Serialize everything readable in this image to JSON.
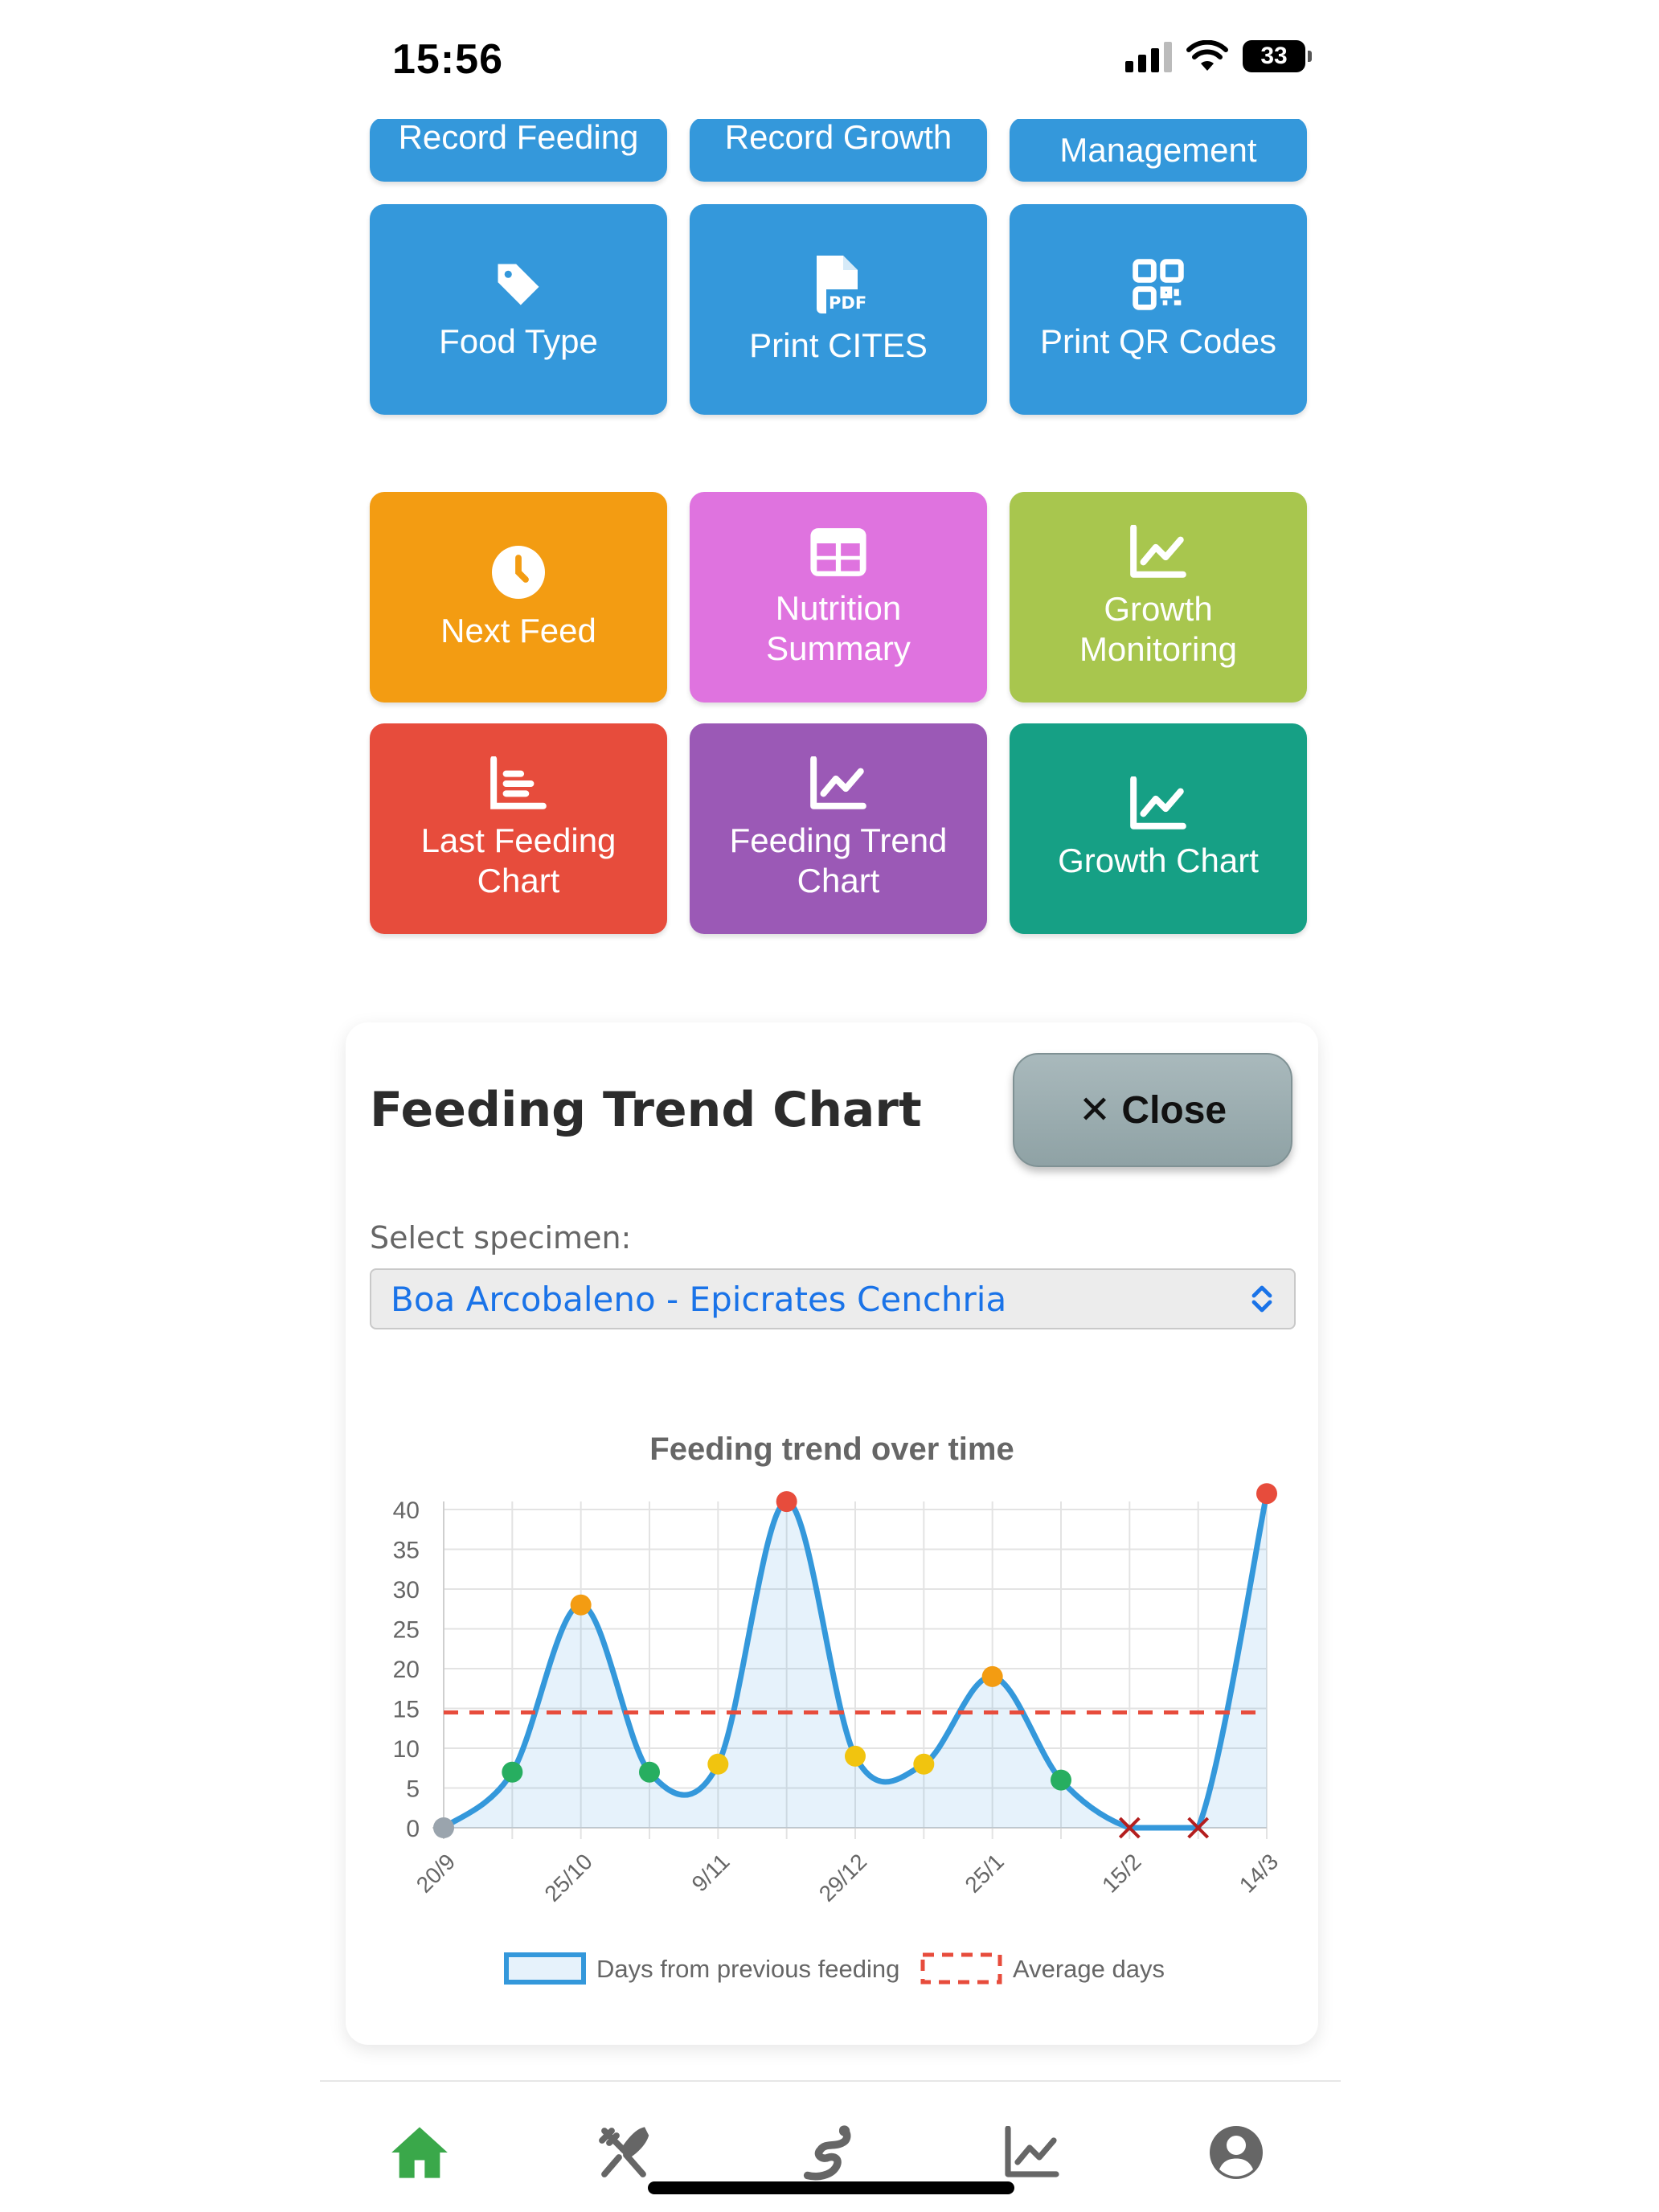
{
  "status_bar": {
    "time": "15:56",
    "battery": "33"
  },
  "tiles_top_partial": [
    {
      "label": "Record Feeding"
    },
    {
      "label": "Record Growth"
    },
    {
      "label": "Management"
    }
  ],
  "tiles_row1": [
    {
      "label": "Food Type",
      "icon": "tag-icon"
    },
    {
      "label": "Print CITES",
      "icon": "pdf-file-icon"
    },
    {
      "label": "Print QR Codes",
      "icon": "qr-code-icon"
    }
  ],
  "tiles_row2": [
    {
      "label": "Next Feed",
      "icon": "clock-icon",
      "color": "#f39c12"
    },
    {
      "label": "Nutrition Summary",
      "icon": "table-icon",
      "color": "#df73df"
    },
    {
      "label": "Growth Monitoring",
      "icon": "line-chart-icon",
      "color": "#a8c64e"
    }
  ],
  "tiles_row3": [
    {
      "label": "Last Feeding Chart",
      "icon": "bar-chart-icon",
      "color": "#e74c3c"
    },
    {
      "label": "Feeding Trend Chart",
      "icon": "line-chart-icon",
      "color": "#9b59b6"
    },
    {
      "label": "Growth Chart",
      "icon": "line-chart-icon",
      "color": "#16a085"
    }
  ],
  "card": {
    "title": "Feeding Trend Chart",
    "close_label": "✕ Close",
    "select_label": "Select specimen:",
    "select_value": "Boa Arcobaleno - Epicrates Cenchria"
  },
  "chart_data": {
    "type": "line",
    "title": "Feeding trend over time",
    "x": [
      "20/9",
      "",
      "25/10",
      "",
      "9/11",
      "",
      "29/12",
      "",
      "25/1",
      "",
      "15/2",
      "",
      "14/3"
    ],
    "series": [
      {
        "name": "Days from previous feeding",
        "values": [
          0,
          7,
          28,
          7,
          8,
          41,
          9,
          8,
          19,
          6,
          0,
          0,
          42
        ],
        "point_colors": [
          "#9aa4ad",
          "#27ae60",
          "#f39c12",
          "#27ae60",
          "#f1c40f",
          "#e74c3c",
          "#f1c40f",
          "#f1c40f",
          "#f39c12",
          "#27ae60",
          "cross",
          "cross",
          "#e74c3c"
        ],
        "color": "#3498db"
      },
      {
        "name": "Average days",
        "values": [
          14.5,
          14.5,
          14.5,
          14.5,
          14.5,
          14.5,
          14.5,
          14.5,
          14.5,
          14.5,
          14.5,
          14.5,
          14.5
        ],
        "color": "#e74c3c",
        "style": "dashed"
      }
    ],
    "ylim": [
      0,
      40
    ],
    "yticks": [
      0,
      5,
      10,
      15,
      20,
      25,
      30,
      35,
      40
    ],
    "grid": true,
    "legend": "bottom"
  },
  "bottom_nav": [
    {
      "name": "home",
      "active_color": "#3aa84a"
    },
    {
      "name": "feeding"
    },
    {
      "name": "specimens"
    },
    {
      "name": "charts"
    },
    {
      "name": "profile"
    }
  ]
}
